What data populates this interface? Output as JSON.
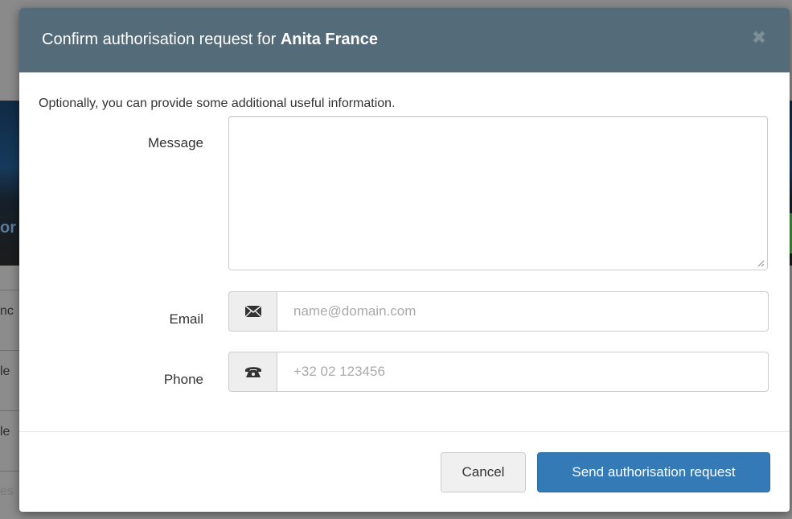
{
  "modal": {
    "title_prefix": "Confirm authorisation request for ",
    "title_name": "Anita France",
    "close_glyph": "✖",
    "intro": "Optionally, you can provide some additional useful information.",
    "message_label": "Message",
    "email_label": "Email",
    "email_placeholder": "name@domain.com",
    "email_icon": "envelope-icon",
    "phone_label": "Phone",
    "phone_placeholder": "+32 02 123456",
    "phone_icon": "phone-icon",
    "cancel_label": "Cancel",
    "send_label": "Send authorisation request"
  },
  "background": {
    "fragments": [
      "or",
      "nc",
      "le",
      "le",
      "es"
    ]
  },
  "colors": {
    "header_bg": "#546b7a",
    "primary_button": "#337ab7"
  }
}
